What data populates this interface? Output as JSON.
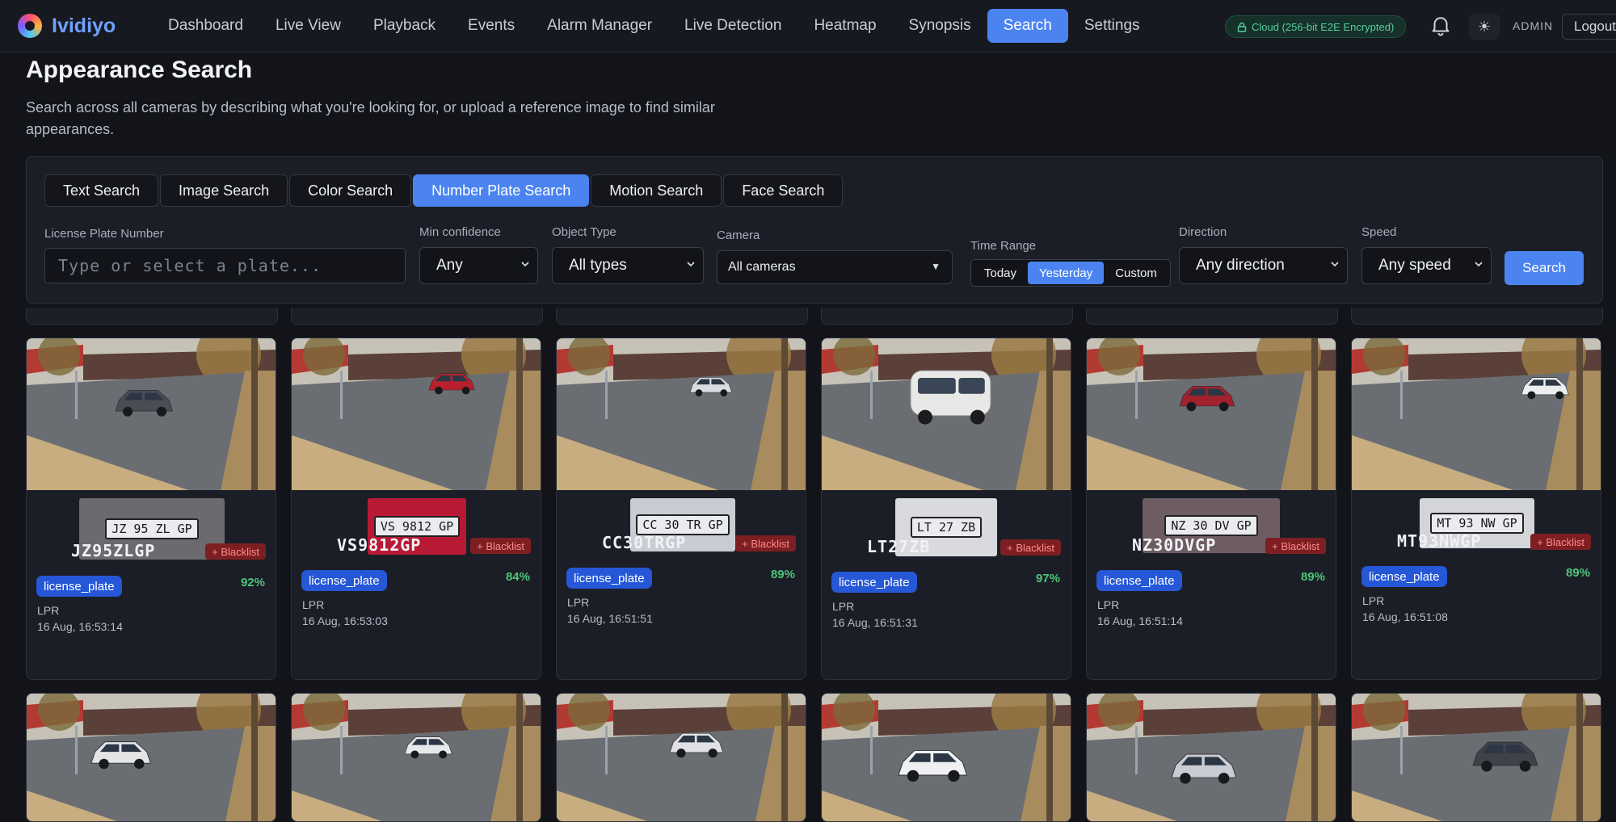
{
  "app": {
    "name": "Ividiyo"
  },
  "nav": [
    {
      "label": "Dashboard"
    },
    {
      "label": "Live View"
    },
    {
      "label": "Playback"
    },
    {
      "label": "Events"
    },
    {
      "label": "Alarm Manager"
    },
    {
      "label": "Live Detection"
    },
    {
      "label": "Heatmap"
    },
    {
      "label": "Synopsis"
    },
    {
      "label": "Search",
      "active": true
    },
    {
      "label": "Settings"
    }
  ],
  "header": {
    "cloud_badge": "Cloud (256-bit E2E Encrypted)",
    "user": "ADMIN",
    "logout_label": "Logout"
  },
  "page": {
    "title": "Appearance Search",
    "description": "Search across all cameras by describing what you're looking for, or upload a reference image to find similar appearances."
  },
  "tabs": [
    {
      "label": "Text Search"
    },
    {
      "label": "Image Search"
    },
    {
      "label": "Color Search"
    },
    {
      "label": "Number Plate Search",
      "active": true
    },
    {
      "label": "Motion Search"
    },
    {
      "label": "Face Search"
    }
  ],
  "filters": {
    "plate_label": "License Plate Number",
    "plate_placeholder": "Type or select a plate...",
    "min_conf_label": "Min confidence",
    "min_conf_value": "Any",
    "object_type_label": "Object Type",
    "object_type_value": "All types",
    "camera_label": "Camera",
    "camera_value": "All cameras",
    "time_range_label": "Time Range",
    "time_options": [
      "Today",
      "Yesterday",
      "Custom"
    ],
    "time_selected": "Yesterday",
    "direction_label": "Direction",
    "direction_value": "Any direction",
    "speed_label": "Speed",
    "speed_value": "Any speed",
    "search_label": "Search"
  },
  "results": [
    {
      "plate": "JZ95ZLGP",
      "plate_crop": "JZ 95 ZL GP",
      "badge": "+ Blacklist",
      "tag": "license_plate",
      "confidence": "92%",
      "source": "LPR",
      "time": "16 Aug, 16:53:14",
      "car_color": "#4a4d55"
    },
    {
      "plate": "VS9812GP",
      "plate_crop": "VS 9812 GP",
      "badge": "+ Blacklist",
      "tag": "license_plate",
      "confidence": "84%",
      "source": "LPR",
      "time": "16 Aug, 16:53:03",
      "car_color": "#b8202d"
    },
    {
      "plate": "CC30TRGP",
      "plate_crop": "CC 30 TR GP",
      "badge": "+ Blacklist",
      "tag": "license_plate",
      "confidence": "89%",
      "source": "LPR",
      "time": "16 Aug, 16:51:51",
      "car_color": "#d8dbe0"
    },
    {
      "plate": "LT27ZB",
      "plate_crop": "LT 27 ZB",
      "badge": "+ Blacklist",
      "tag": "license_plate",
      "confidence": "97%",
      "source": "LPR",
      "time": "16 Aug, 16:51:31",
      "car_color": "#e8e8e6"
    },
    {
      "plate": "NZ30DVGP",
      "plate_crop": "NZ 30 DV GP",
      "badge": "+ Blacklist",
      "tag": "license_plate",
      "confidence": "89%",
      "source": "LPR",
      "time": "16 Aug, 16:51:14",
      "car_color": "#a3212c"
    },
    {
      "plate": "MT93NWGP",
      "plate_crop": "MT 93 NW GP",
      "badge": "+ Blacklist",
      "tag": "license_plate",
      "confidence": "89%",
      "source": "LPR",
      "time": "16 Aug, 16:51:08",
      "car_color": "#eceeef"
    }
  ],
  "second_row_car_colors": [
    "#e4e5e7",
    "#e7e8ea",
    "#dfe1e4",
    "#eef0f1",
    "#c9ccd2",
    "#3f4249"
  ]
}
